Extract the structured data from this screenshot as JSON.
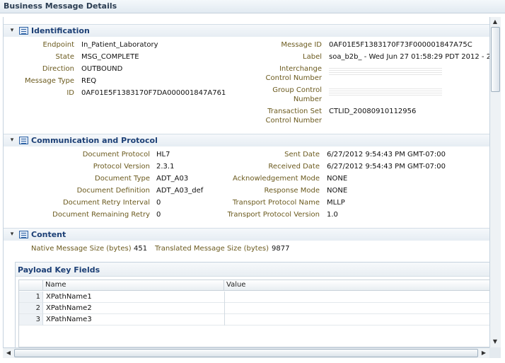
{
  "window": {
    "title": "Business Message Details"
  },
  "sections": {
    "identification": {
      "title": "Identification",
      "left": [
        {
          "label": "Endpoint",
          "value": "In_Patient_Laboratory"
        },
        {
          "label": "State",
          "value": "MSG_COMPLETE"
        },
        {
          "label": "Direction",
          "value": "OUTBOUND"
        },
        {
          "label": "Message Type",
          "value": "REQ"
        },
        {
          "label": "ID",
          "value": "0AF01E5F1383170F7DA000001847A761"
        }
      ],
      "right": [
        {
          "label": "Message ID",
          "value": "0AF01E5F1383170F73F000001847A75C"
        },
        {
          "label": "Label",
          "value": "soa_b2b_ - Wed Jun 27 01:58:29 PDT 2012 - 2"
        },
        {
          "label_line1": "Interchange",
          "label_line2": "Control Number",
          "value": ""
        },
        {
          "label_line1": "Group Control",
          "label_line2": "Number",
          "value": ""
        },
        {
          "label_line1": "Transaction Set",
          "label_line2": "Control Number",
          "value": "CTLID_20080910112956"
        }
      ]
    },
    "communication": {
      "title": "Communication and Protocol",
      "left": [
        {
          "label": "Document Protocol",
          "value": "HL7"
        },
        {
          "label": "Protocol Version",
          "value": "2.3.1"
        },
        {
          "label": "Document Type",
          "value": "ADT_A03"
        },
        {
          "label": "Document Definition",
          "value": "ADT_A03_def"
        },
        {
          "label": "Document Retry Interval",
          "value": "0"
        },
        {
          "label": "Document Remaining Retry",
          "value": "0"
        }
      ],
      "right": [
        {
          "label": "Sent Date",
          "value": "6/27/2012 9:54:43 PM GMT-07:00"
        },
        {
          "label": "Received Date",
          "value": "6/27/2012 9:54:43 PM GMT-07:00"
        },
        {
          "label": "Acknowledgement Mode",
          "value": "NONE"
        },
        {
          "label": "Response Mode",
          "value": "NONE"
        },
        {
          "label": "Transport Protocol Name",
          "value": "MLLP"
        },
        {
          "label": "Transport Protocol Version",
          "value": "1.0"
        }
      ]
    },
    "content": {
      "title": "Content",
      "native_label": "Native Message Size (bytes)",
      "native_value": "451",
      "translated_label": "Translated Message Size (bytes)",
      "translated_value": "9877"
    }
  },
  "payload": {
    "title": "Payload Key Fields",
    "columns": [
      "Name",
      "Value"
    ],
    "rows": [
      {
        "num": "1",
        "name": "XPathName1",
        "value": ""
      },
      {
        "num": "2",
        "name": "XPathName2",
        "value": ""
      },
      {
        "num": "3",
        "name": "XPathName3",
        "value": ""
      }
    ]
  },
  "icons": {
    "collapse": "chevron-down-icon",
    "section": "list-icon",
    "scroll_up": "arrow-up-icon",
    "scroll_down": "arrow-down-icon",
    "scroll_left": "arrow-left-icon",
    "scroll_right": "arrow-right-icon"
  },
  "colors": {
    "label": "#6b5a1e",
    "section_title": "#1c3f75",
    "header_bg": "#e6edf3"
  }
}
